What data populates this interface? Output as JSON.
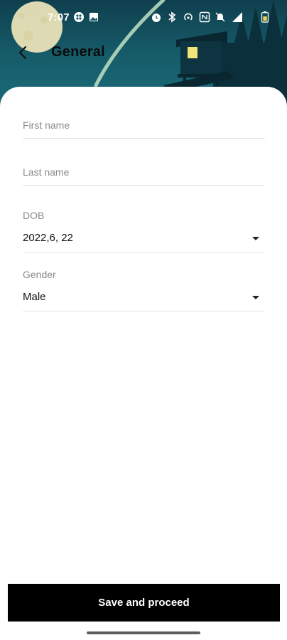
{
  "status_bar": {
    "time": "7:07",
    "icons": [
      "app-notification-icon",
      "image-icon",
      "alarm-icon",
      "bluetooth-icon",
      "hotspot-icon",
      "nfc-icon",
      "mute-icon",
      "signal-icon",
      "battery-icon"
    ]
  },
  "header": {
    "title": "General",
    "back_icon": "chevron-left-icon"
  },
  "form": {
    "first_name": {
      "placeholder": "First name",
      "value": ""
    },
    "last_name": {
      "placeholder": "Last name",
      "value": ""
    },
    "dob": {
      "label": "DOB",
      "value": "2022,6, 22"
    },
    "gender": {
      "label": "Gender",
      "value": "Male"
    }
  },
  "actions": {
    "save_label": "Save and proceed"
  },
  "colors": {
    "header_sky": "#165a68",
    "button_bg": "#000000",
    "button_text": "#ffffff",
    "label_gray": "#8a8a8a",
    "divider": "#e3e3e3"
  }
}
